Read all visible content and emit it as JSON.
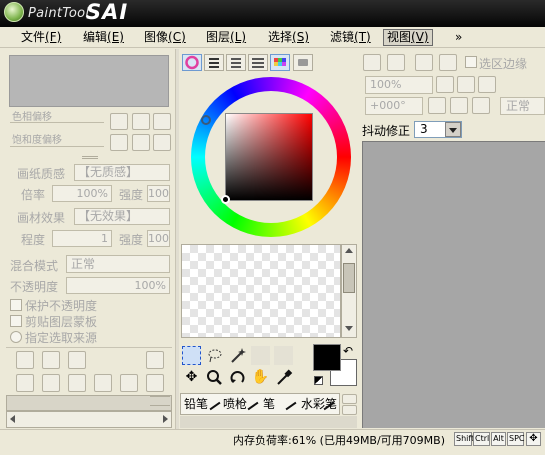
{
  "app": {
    "logo_small": "PaintTool",
    "logo_big": "SAI"
  },
  "menus": [
    {
      "label": "文件",
      "key": "(F)"
    },
    {
      "label": "编辑",
      "key": "(E)"
    },
    {
      "label": "图像",
      "key": "(C)"
    },
    {
      "label": "图层",
      "key": "(L)"
    },
    {
      "label": "选择",
      "key": "(S)"
    },
    {
      "label": "滤镜",
      "key": "(T)"
    },
    {
      "label": "视图",
      "key": "(V)"
    },
    {
      "label": "»",
      "key": ""
    }
  ],
  "layer_panel": {
    "hue_label": "色相偏移",
    "sat_label": "饱和度偏移",
    "paper_label": "画纸质感",
    "paper_value": "【无质感】",
    "paper_scale_label": "倍率",
    "paper_scale_value": "100%",
    "paper_strength_label": "强度",
    "paper_strength_value": "100",
    "material_label": "画材效果",
    "material_value": "【无效果】",
    "degree_label": "程度",
    "degree_value": "1",
    "material_strength_label": "强度",
    "material_strength_value": "100",
    "blend_label": "混合模式",
    "blend_value": "正常",
    "opacity_label": "不透明度",
    "opacity_value": "100%",
    "protect_label": "保护不透明度",
    "clip_label": "剪贴图层蒙板",
    "source_label": "指定选取来源"
  },
  "color": {
    "primary": "#000000",
    "secondary": "#ffffff",
    "hue": "#ff0000"
  },
  "tools": {
    "brushes": [
      "铅笔",
      "喷枪",
      "笔",
      "水彩笔"
    ]
  },
  "view_panel": {
    "anti_alias_label": "选区边缘",
    "zoom_value": "100%",
    "rotate_value": "+000°",
    "mode_label": "正常",
    "stabilizer_label": "抖动修正",
    "stabilizer_value": "3"
  },
  "status": {
    "memory": "内存负荷率:61% (已用49MB/可用709MB)",
    "keys": [
      "Shift",
      "Ctrl",
      "Alt",
      "SPC",
      "✥"
    ]
  }
}
